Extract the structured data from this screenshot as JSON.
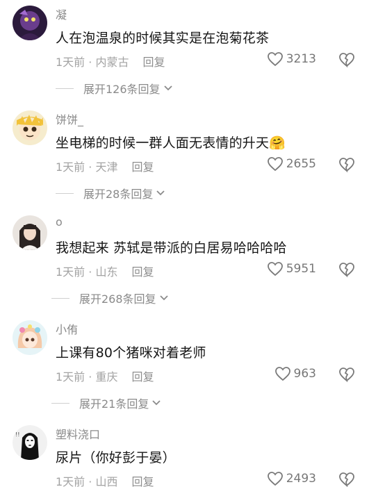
{
  "comments": [
    {
      "username": "凝",
      "content": "人在泡温泉的时候其实是在泡菊花茶",
      "time": "1天前",
      "location": "内蒙古",
      "reply_label": "回复",
      "likes": "3213",
      "expand_label": "展开126条回复"
    },
    {
      "username": "饼饼_",
      "content": "坐电梯的时候一群人面无表情的升天🤗",
      "time": "1天前",
      "location": "天津",
      "reply_label": "回复",
      "likes": "2655",
      "expand_label": "展开28条回复"
    },
    {
      "username": "o",
      "content": "我想起来 苏轼是带派的白居易哈哈哈哈",
      "time": "1天前",
      "location": "山东",
      "reply_label": "回复",
      "likes": "5951",
      "expand_label": "展开268条回复"
    },
    {
      "username": "小侑",
      "content": "上课有80个猪咪对着老师",
      "time": "1天前",
      "location": "重庆",
      "reply_label": "回复",
      "likes": "963",
      "expand_label": "展开21条回复"
    },
    {
      "username": "塑料浇口",
      "content": "尿片（你好彭于晏）",
      "time": "1天前",
      "location": "山西",
      "reply_label": "回复",
      "likes": "2493"
    }
  ],
  "separator": " · ",
  "icons": {
    "like": "heart-outline-icon",
    "dislike": "broken-heart-icon",
    "expand": "chevron-down-icon"
  },
  "colors": {
    "text_primary": "#161616",
    "text_secondary": "#8a8a8a",
    "text_meta": "#a3a3a3"
  }
}
